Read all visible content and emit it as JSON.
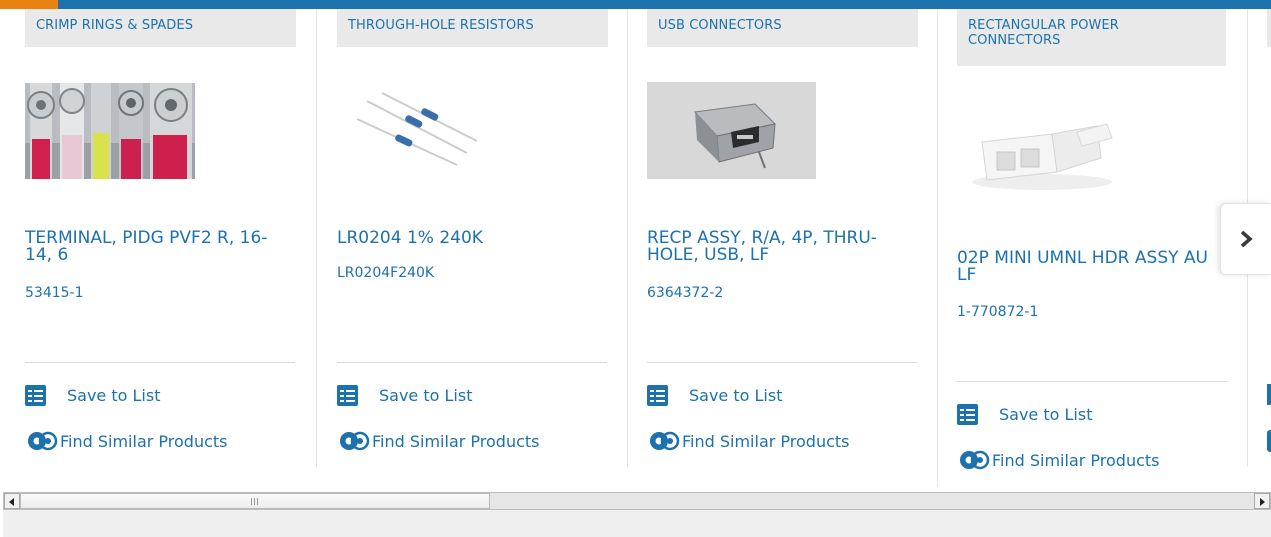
{
  "products": [
    {
      "category": "CRIMP RINGS & SPADES",
      "title": "TERMINAL, PIDG PVF2 R, 16-14, 6",
      "part_number": "53415-1",
      "save_label": "Save to List",
      "similar_label": "Find Similar Products"
    },
    {
      "category": "THROUGH-HOLE RESISTORS",
      "title": "LR0204 1% 240K",
      "part_number": "LR0204F240K",
      "save_label": "Save to List",
      "similar_label": "Find Similar Products"
    },
    {
      "category": "USB CONNECTORS",
      "title": "RECP ASSY, R/A, 4P, THRU-HOLE, USB, LF",
      "part_number": "6364372-2",
      "save_label": "Save to List",
      "similar_label": "Find Similar Products"
    },
    {
      "category": "RECTANGULAR POWER CONNECTORS",
      "title": "02P MINI UMNL HDR ASSY AU LF",
      "part_number": "1-770872-1",
      "save_label": "Save to List",
      "similar_label": "Find Similar Products"
    }
  ],
  "carousel": {
    "next_icon": "chevron-right-icon"
  },
  "scrollbar": {
    "left_icon": "triangle-left-icon",
    "right_icon": "triangle-right-icon"
  },
  "colors": {
    "link": "#1c72ad",
    "accent": "#e8830f",
    "category_bg": "#e9e9e9"
  }
}
